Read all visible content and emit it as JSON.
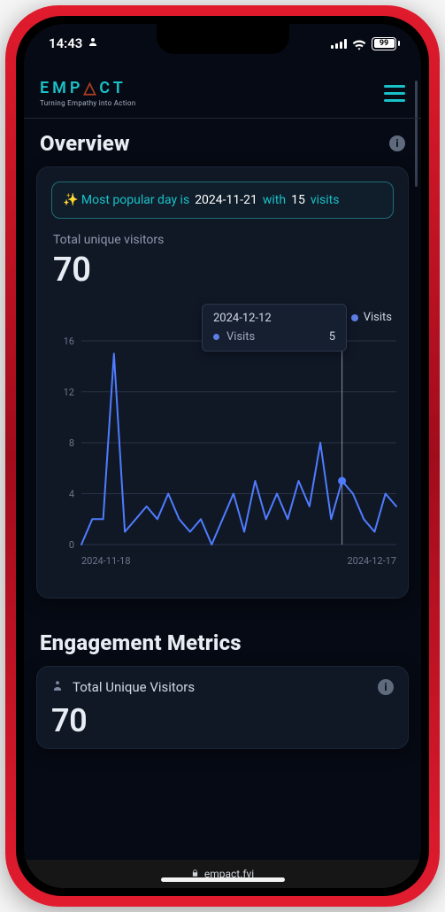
{
  "status": {
    "time": "14:43",
    "battery_pct": "99"
  },
  "brand": {
    "name_pre": "EMP",
    "name_post": "CT",
    "triangle": "△",
    "tagline": "Turning Empathy into Action"
  },
  "overview": {
    "title": "Overview",
    "highlight_prefix": "✨  Most popular day is ",
    "highlight_date": "2024-11-21",
    "highlight_mid": " with ",
    "highlight_count": "15",
    "highlight_suffix": " visits",
    "stat_label": "Total unique visitors",
    "stat_value": "70"
  },
  "chart": {
    "legend_label": "Visits",
    "tooltip_date": "2024-12-12",
    "tooltip_series": "Visits",
    "tooltip_value": "5",
    "x_start_label": "2024-11-18",
    "x_end_label": "2024-12-17",
    "y0": "0",
    "y1": "4",
    "y2": "8",
    "y3": "12",
    "y4": "16"
  },
  "engagement": {
    "title": "Engagement Metrics",
    "metric1_label": "Total Unique Visitors",
    "metric1_value": "70"
  },
  "browser": {
    "domain": "empact.fyi"
  },
  "chart_data": {
    "type": "line",
    "title": "Total unique visitors",
    "xlabel": "",
    "ylabel": "",
    "ylim": [
      0,
      16
    ],
    "x_tick_labels": [
      "2024-11-18",
      "2024-12-17"
    ],
    "y_ticks": [
      0,
      4,
      8,
      12,
      16
    ],
    "legend": [
      "Visits"
    ],
    "x": [
      "2024-11-18",
      "2024-11-19",
      "2024-11-20",
      "2024-11-21",
      "2024-11-22",
      "2024-11-23",
      "2024-11-24",
      "2024-11-25",
      "2024-11-26",
      "2024-11-27",
      "2024-11-28",
      "2024-11-29",
      "2024-11-30",
      "2024-12-01",
      "2024-12-02",
      "2024-12-03",
      "2024-12-04",
      "2024-12-05",
      "2024-12-06",
      "2024-12-07",
      "2024-12-08",
      "2024-12-09",
      "2024-12-10",
      "2024-12-11",
      "2024-12-12",
      "2024-12-13",
      "2024-12-14",
      "2024-12-15",
      "2024-12-16",
      "2024-12-17"
    ],
    "series": [
      {
        "name": "Visits",
        "values": [
          0,
          2,
          2,
          15,
          1,
          2,
          3,
          2,
          4,
          2,
          1,
          2,
          0,
          2,
          4,
          1,
          5,
          2,
          4,
          2,
          5,
          3,
          8,
          2,
          5,
          4,
          2,
          1,
          4,
          3
        ]
      }
    ],
    "highlight": {
      "x": "2024-12-12",
      "value": 5
    }
  }
}
